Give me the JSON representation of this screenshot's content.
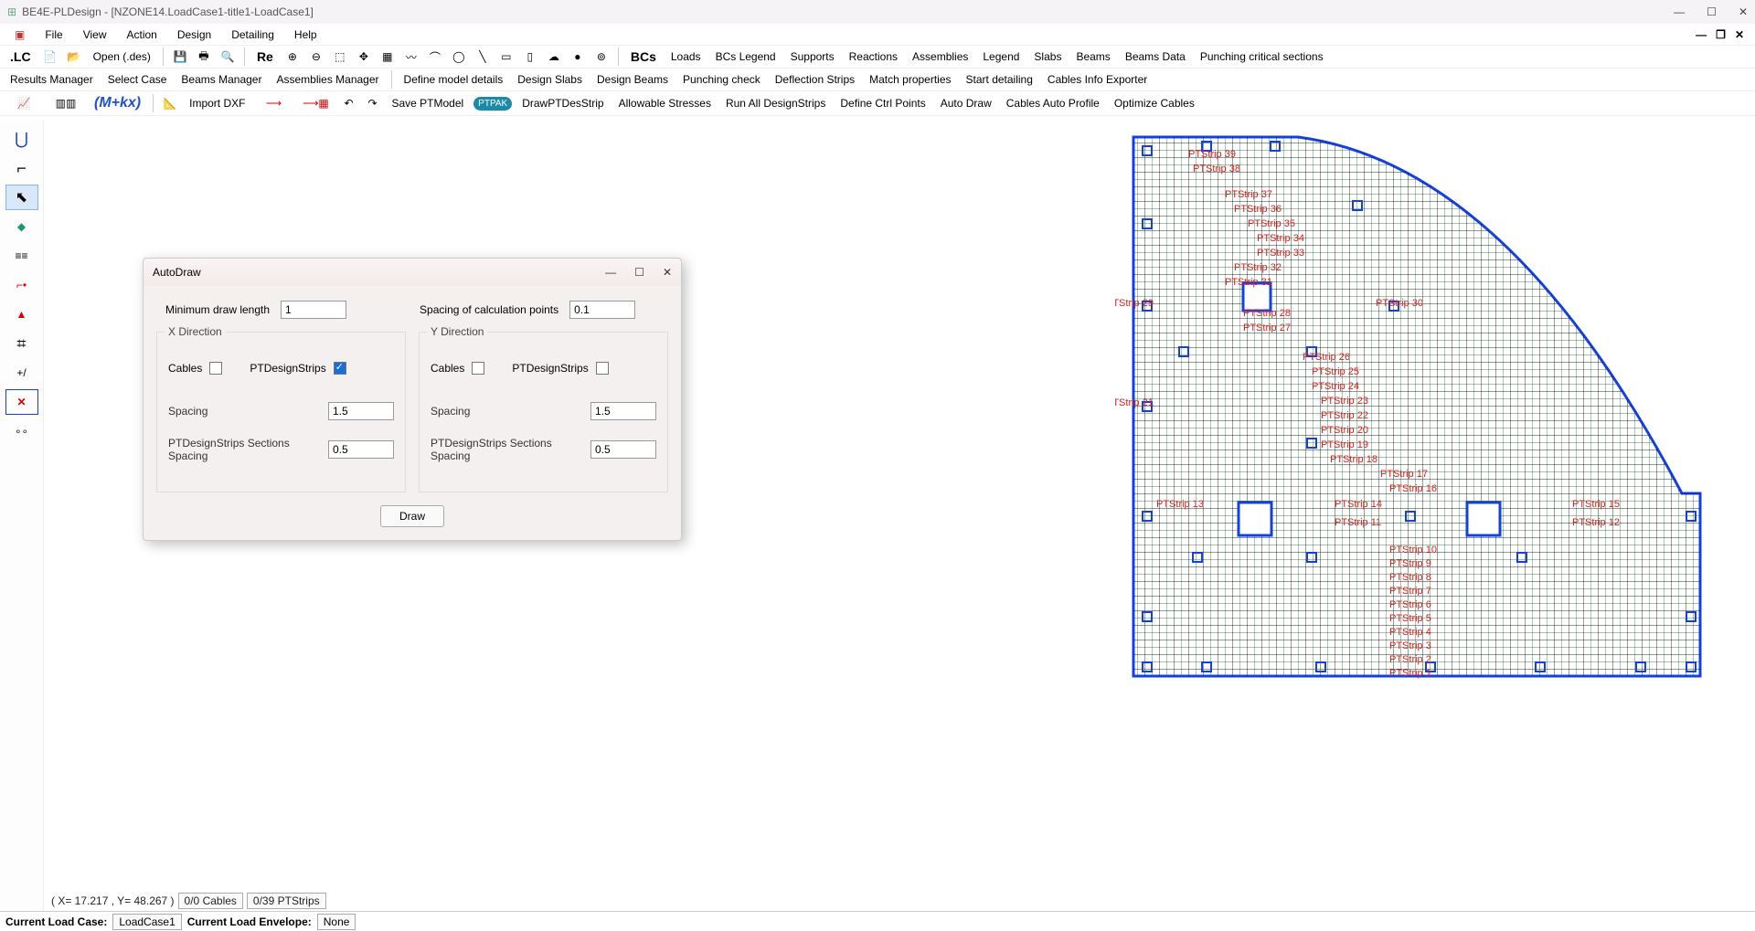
{
  "titlebar": {
    "app": "BE4E-PLDesign - [NZONE14.LoadCase1-title1-LoadCase1]",
    "minimize": "—",
    "maximize": "☐",
    "close": "✕"
  },
  "menubar": {
    "file": "File",
    "view": "View",
    "action": "Action",
    "design": "Design",
    "detailing": "Detailing",
    "help": "Help"
  },
  "toolbar1": {
    "lc": ".LC",
    "open": "Open (.des)",
    "re": "Re",
    "bcs": "BCs",
    "loads": "Loads",
    "bcslegend": "BCs Legend",
    "supports": "Supports",
    "reactions": "Reactions",
    "assemblies": "Assemblies",
    "legend": "Legend",
    "slabs": "Slabs",
    "beams": "Beams",
    "beamsdata": "Beams Data",
    "punching": "Punching critical sections"
  },
  "toolbar2": {
    "resultsmgr": "Results Manager",
    "selectcase": "Select Case",
    "beamsmgr": "Beams Manager",
    "asmmgr": "Assemblies Manager",
    "definemodel": "Define model details",
    "designslabs": "Design Slabs",
    "designbeams": "Design Beams",
    "punchcheck": "Punching check",
    "deflection": "Deflection Strips",
    "matchprops": "Match properties",
    "startdetail": "Start detailing",
    "cablesexp": "Cables Info Exporter"
  },
  "toolbar3": {
    "mkx": "(M+kx)",
    "importdxf": "Import DXF",
    "saveptmodel": "Save PTModel",
    "ptpak": "PTPAK",
    "drawpt": "DrawPTDesStrip",
    "allowable": "Allowable Stresses",
    "runall": "Run All DesignStrips",
    "definectrl": "Define Ctrl Points",
    "autodraw": "Auto Draw",
    "cablesauto": "Cables Auto Profile",
    "optimize": "Optimize Cables"
  },
  "dialog": {
    "title": "AutoDraw",
    "mindrawlen_label": "Minimum draw length",
    "mindrawlen_value": "1",
    "spacingcalc_label": "Spacing of calculation points",
    "spacingcalc_value": "0.1",
    "xdir": "X Direction",
    "ydir": "Y Direction",
    "cables_label": "Cables",
    "ptdesign_label": "PTDesignStrips",
    "spacing_label": "Spacing",
    "x_spacing": "1.5",
    "y_spacing": "1.5",
    "sectspacing_label": "PTDesignStrips Sections Spacing",
    "x_sectspacing": "0.5",
    "y_sectspacing": "0.5",
    "draw_btn": "Draw"
  },
  "status": {
    "coords": "( X= 17.217 , Y= 48.267 )",
    "cables": "0/0 Cables",
    "ptstrips": "0/39 PTStrips"
  },
  "footer": {
    "loadcase_label": "Current Load Case:",
    "loadcase": "LoadCase1",
    "loadenv_label": "Current Load Envelope:",
    "loadenv": "None"
  },
  "chart_data": {
    "type": "table",
    "description": "PTStrip labels overlaid on slab mesh",
    "strips": [
      "PTStrip 1",
      "PTStrip 2",
      "PTStrip 3",
      "PTStrip 4",
      "PTStrip 5",
      "PTStrip 6",
      "PTStrip 7",
      "PTStrip 8",
      "PTStrip 9",
      "PTStrip 10",
      "PTStrip 11",
      "PTStrip 12",
      "PTStrip 13",
      "PTStrip 14",
      "PTStrip 15",
      "PTStrip 16",
      "PTStrip 17",
      "PTStrip 18",
      "PTStrip 19",
      "PTStrip 20",
      "PTStrip 21",
      "PTStrip 22",
      "PTStrip 23",
      "PTStrip 24",
      "PTStrip 25",
      "PTStrip 26",
      "PTStrip 27",
      "PTStrip 28",
      "PTStrip 29",
      "PTStrip 30",
      "PTStrip 31",
      "PTStrip 32",
      "PTStrip 33",
      "PTStrip 34",
      "PTStrip 35",
      "PTStrip 36",
      "PTStrip 37",
      "PTStrip 38",
      "PTStrip 39"
    ]
  }
}
